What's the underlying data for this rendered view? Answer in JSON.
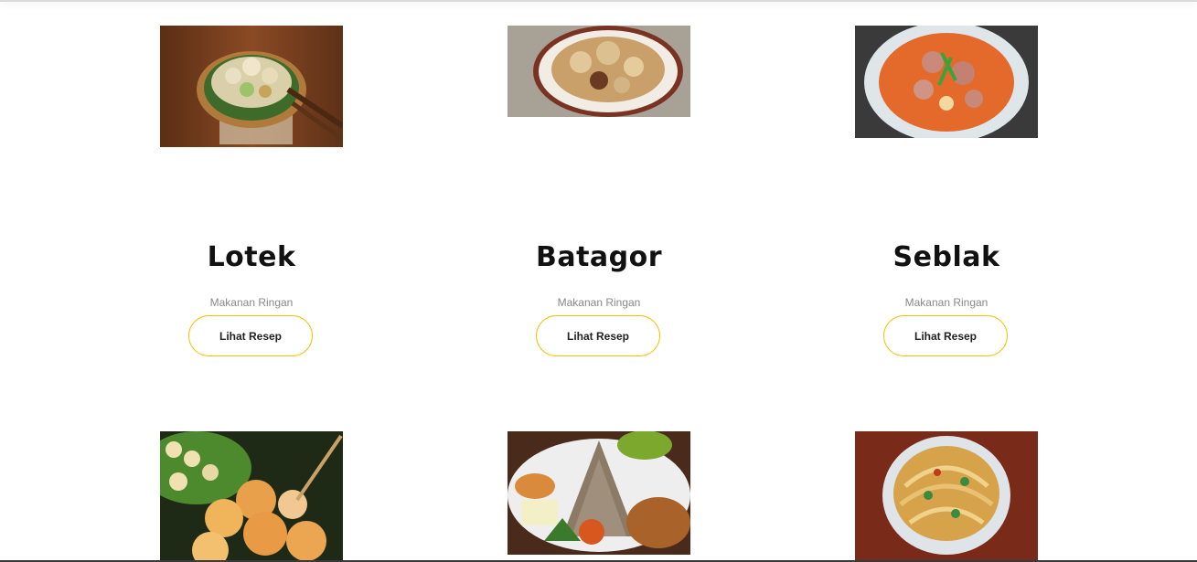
{
  "recipes": [
    {
      "name": "Lotek",
      "category": "Makanan Ringan",
      "button": "Lihat Resep"
    },
    {
      "name": "Batagor",
      "category": "Makanan Ringan",
      "button": "Lihat Resep"
    },
    {
      "name": "Seblak",
      "category": "Makanan Ringan",
      "button": "Lihat Resep"
    }
  ],
  "colors": {
    "button_border": "#f2c200",
    "title": "#111111",
    "category": "#888888"
  }
}
